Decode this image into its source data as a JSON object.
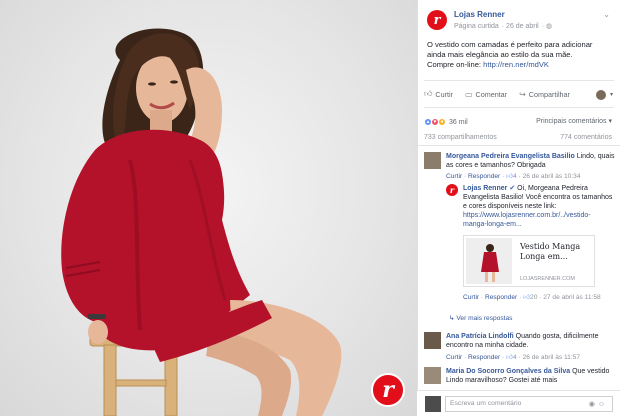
{
  "post": {
    "page_name": "Lojas Renner",
    "page_logo_letter": "r",
    "meta_prefix": "Página curtida",
    "date": "26 de abril",
    "text_line1": "O vestido com camadas é perfeito para adicionar",
    "text_line2": "ainda mais elegância ao estilo da sua mãe.",
    "text_line3_prefix": "Compre on-line:",
    "text_link": "http://ren.ner/mdVK"
  },
  "actions": {
    "like": "Curtir",
    "comment": "Comentar",
    "share": "Compartilhar"
  },
  "reactions": {
    "count": "36 mil",
    "sort": "Principais comentários"
  },
  "stats": {
    "shares": "733 compartilhamentos",
    "comments": "774 comentários"
  },
  "comments": [
    {
      "name": "Morgeana Pedreira Evangelista Basilio",
      "text": "Lindo, quais as cores e tamanhos? Obrigada",
      "like": "Curtir",
      "reply": "Responder",
      "likes": "4",
      "time": "26 de abril às 10:34"
    },
    {
      "name": "Lojas Renner",
      "text": "Oi, Morgeana Pedreira Evangelista Basilio! Você encontra os tamanhos e cores disponíveis neste link:",
      "link": "https://www.lojasrenner.com.br/../vestido-manga-longa-em...",
      "card_title": "Vestido Manga Longa em...",
      "card_domain": "LOJASRENNER.COM",
      "like": "Curtir",
      "reply": "Responder",
      "likes": "20",
      "time": "27 de abril às 11:58"
    },
    {
      "view_more": "Ver mais respostas"
    },
    {
      "name": "Ana Patrícia Lindolfi",
      "text": "Quando gosta, dificilmente encontro na minha cidade.",
      "like": "Curtir",
      "reply": "Responder",
      "likes": "4",
      "time": "26 de abril às 11:57"
    },
    {
      "name": "Maria Do Socorro Gonçalves da Silva",
      "text": "Que vestido Lindo maravilhoso? Gostei até mais"
    }
  ],
  "composer": {
    "placeholder": "Escreva um comentário"
  },
  "colors": {
    "brand": "#e20f1a",
    "link": "#365899",
    "dress": "#b3122a"
  }
}
